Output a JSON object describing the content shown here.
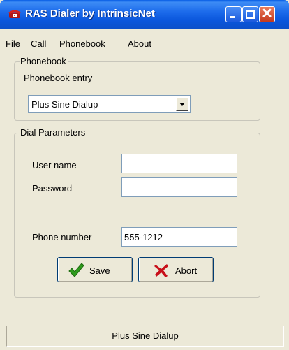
{
  "window": {
    "title": "RAS Dialer by IntrinsicNet"
  },
  "menu": [
    "File",
    "Call",
    "Phonebook",
    "About"
  ],
  "phonebook": {
    "group_label": "Phonebook",
    "entry_label": "Phonebook entry",
    "selected_entry": "Plus Sine Dialup"
  },
  "dial": {
    "group_label": "Dial Parameters",
    "username_label": "User name",
    "username_value": "",
    "password_label": "Password",
    "password_value": "",
    "phone_label": "Phone number",
    "phone_value": "555-1212"
  },
  "buttons": {
    "save_label": "Save",
    "abort_label": "Abort"
  },
  "status": {
    "text": "Plus Sine Dialup"
  },
  "icons": {
    "app": "telephone-icon",
    "save": "checkmark-icon",
    "abort": "x-icon",
    "minimize": "minimize-icon",
    "maximize": "maximize-icon",
    "close": "close-icon"
  },
  "colors": {
    "titlebar": "#0A56DC",
    "window_bg": "#ECE9D8",
    "close_button": "#C4391C",
    "save_icon": "#2E9A1C",
    "abort_icon": "#C8101A"
  }
}
